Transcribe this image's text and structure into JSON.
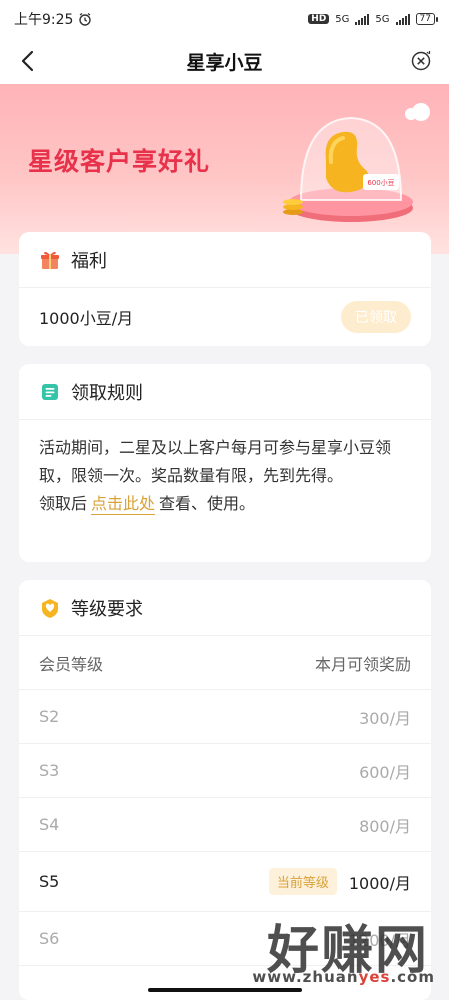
{
  "status_bar": {
    "time": "上午9:25",
    "hd": "HD",
    "signal1": "5G",
    "signal2": "5G",
    "battery": "77"
  },
  "nav": {
    "title": "星享小豆"
  },
  "banner": {
    "title": "星级客户享好礼",
    "tag": "600小豆"
  },
  "benefit": {
    "header": "福利",
    "item": "1000小豆/月",
    "button": "已领取"
  },
  "rules": {
    "header": "领取规则",
    "line1": "活动期间，二星及以上客户每月可参与星享小豆领取，限领一次。奖品数量有限，先到先得。",
    "line2_prefix": "领取后",
    "line2_link": "点击此处",
    "line2_suffix": "查看、使用。"
  },
  "levels": {
    "header": "等级要求",
    "col_level": "会员等级",
    "col_reward": "本月可领奖励",
    "current_badge": "当前等级",
    "rows": [
      {
        "level": "S2",
        "reward": "300/月"
      },
      {
        "level": "S3",
        "reward": "600/月"
      },
      {
        "level": "S4",
        "reward": "800/月"
      },
      {
        "level": "S5",
        "reward": "1000/月"
      },
      {
        "level": "S6",
        "reward": "1200/月"
      }
    ]
  },
  "watermark": {
    "big": "好赚网",
    "site_pre": "www.zhuan",
    "site_yes": "yes",
    "site_post": ".com"
  },
  "colors": {
    "accent_red": "#e8314a",
    "gold": "#d9a23a",
    "banner_pink": "#ffc6c6"
  }
}
